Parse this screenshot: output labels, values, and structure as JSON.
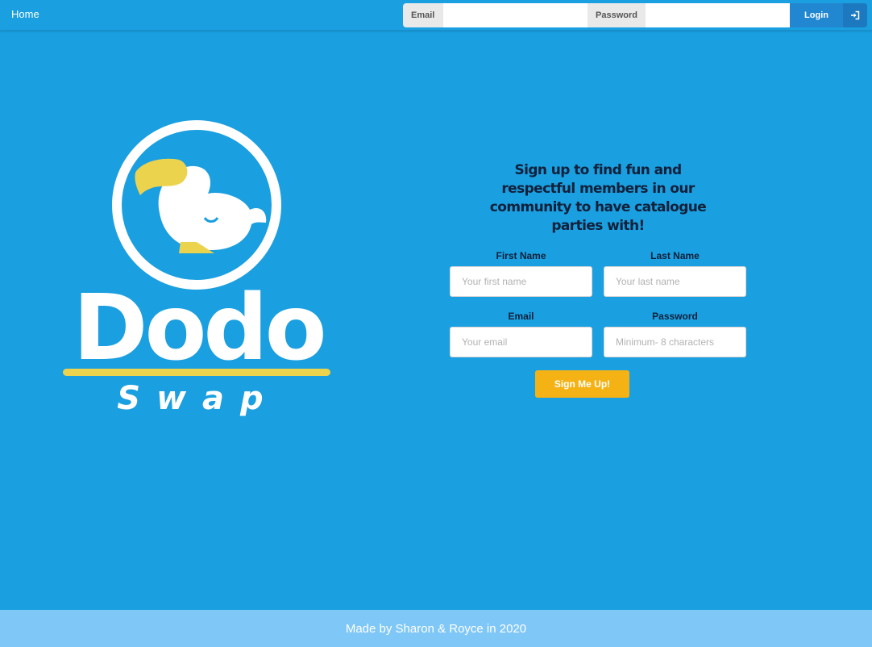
{
  "nav": {
    "home_label": "Home"
  },
  "login": {
    "email_label": "Email",
    "password_label": "Password",
    "button_label": "Login",
    "email_value": "",
    "password_value": ""
  },
  "logo": {
    "text_top": "Dodo",
    "text_bottom": "Swap"
  },
  "signup": {
    "headline": "Sign up to find fun and respectful members in our community to have catalogue parties with!",
    "first_name_label": "First Name",
    "first_name_placeholder": "Your first name",
    "last_name_label": "Last Name",
    "last_name_placeholder": "Your last name",
    "email_label": "Email",
    "email_placeholder": "Your email",
    "password_label": "Password",
    "password_placeholder": "Minimum- 8 characters",
    "button_label": "Sign Me Up!"
  },
  "footer": {
    "text": "Made by Sharon & Royce in 2020"
  },
  "colors": {
    "background": "#1a9fe0",
    "footer": "#7fc7f6",
    "accent": "#f5b214",
    "logo_yellow": "#ecd34e"
  }
}
